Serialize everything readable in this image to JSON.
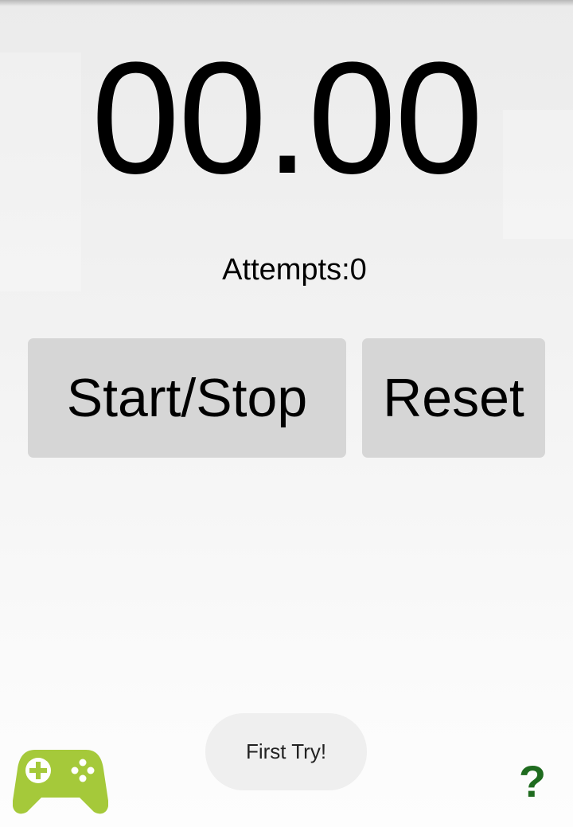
{
  "timer": {
    "display": "00.00"
  },
  "attempts": {
    "label": "Attempts:0"
  },
  "buttons": {
    "start_stop": "Start/Stop",
    "reset": "Reset"
  },
  "toast": {
    "message": "First Try!"
  },
  "icons": {
    "games": "gamepad-icon",
    "help": "question-mark-icon"
  },
  "help": {
    "glyph": "?"
  },
  "colors": {
    "button_bg": "#d6d6d6",
    "gamepad_green": "#a5c93a",
    "help_green": "#1f6b1f",
    "toast_bg": "#efefef"
  }
}
